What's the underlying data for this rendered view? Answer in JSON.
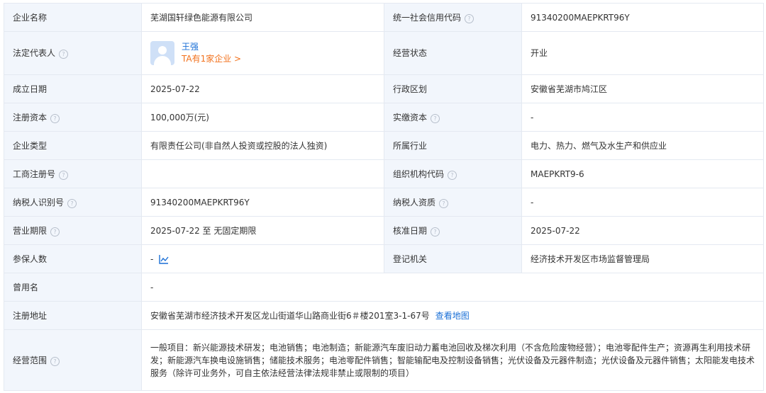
{
  "rows": {
    "company_name": {
      "label": "企业名称",
      "value": "芜湖国轩绿色能源有限公司"
    },
    "credit_code": {
      "label": "统一社会信用代码",
      "value": "91340200MAEPKRT96Y"
    },
    "legal_rep": {
      "label": "法定代表人",
      "name": "王强",
      "count": "TA有1家企业 >"
    },
    "status": {
      "label": "经营状态",
      "value": "开业"
    },
    "founded": {
      "label": "成立日期",
      "value": "2025-07-22"
    },
    "region": {
      "label": "行政区划",
      "value": "安徽省芜湖市鸠江区"
    },
    "reg_capital": {
      "label": "注册资本",
      "value": "100,000万(元)"
    },
    "paid_capital": {
      "label": "实缴资本",
      "value": "-"
    },
    "type": {
      "label": "企业类型",
      "value": "有限责任公司(非自然人投资或控股的法人独资)"
    },
    "industry": {
      "label": "所属行业",
      "value": "电力、热力、燃气及水生产和供应业"
    },
    "biz_reg_no": {
      "label": "工商注册号",
      "value": ""
    },
    "org_code": {
      "label": "组织机构代码",
      "value": "MAEPKRT9-6"
    },
    "taxpayer_id": {
      "label": "纳税人识别号",
      "value": "91340200MAEPKRT96Y"
    },
    "taxpayer_qual": {
      "label": "纳税人资质",
      "value": "-"
    },
    "term": {
      "label": "营业期限",
      "value": "2025-07-22 至 无固定期限"
    },
    "approval_date": {
      "label": "核准日期",
      "value": "2025-07-22"
    },
    "insured": {
      "label": "参保人数",
      "value": "-"
    },
    "authority": {
      "label": "登记机关",
      "value": "经济技术开发区市场监督管理局"
    },
    "former_name": {
      "label": "曾用名",
      "value": "-"
    },
    "address": {
      "label": "注册地址",
      "value": "安徽省芜湖市经济技术开发区龙山街道华山路商业街6＃楼201室3-1-67号",
      "map_link": "查看地图"
    },
    "scope": {
      "label": "经营范围",
      "value": "一般项目：新兴能源技术研发；电池销售；电池制造；新能源汽车废旧动力蓄电池回收及梯次利用（不含危险废物经营）；电池零配件生产；资源再生利用技术研发；新能源汽车换电设施销售；储能技术服务；电池零配件销售；智能输配电及控制设备销售；光伏设备及元器件制造；光伏设备及元器件销售；太阳能发电技术服务（除许可业务外，可自主依法经营法律法规非禁止或限制的项目）"
    }
  },
  "help_glyph": "?",
  "icons": {
    "help": "question-circle-icon",
    "avatar": "user-avatar-icon",
    "trend": "trend-chart-icon"
  },
  "colors": {
    "label_bg": "#f2f6fc",
    "border": "#e4e9f1",
    "link": "#1a6fd6",
    "accent": "#f2711c"
  }
}
